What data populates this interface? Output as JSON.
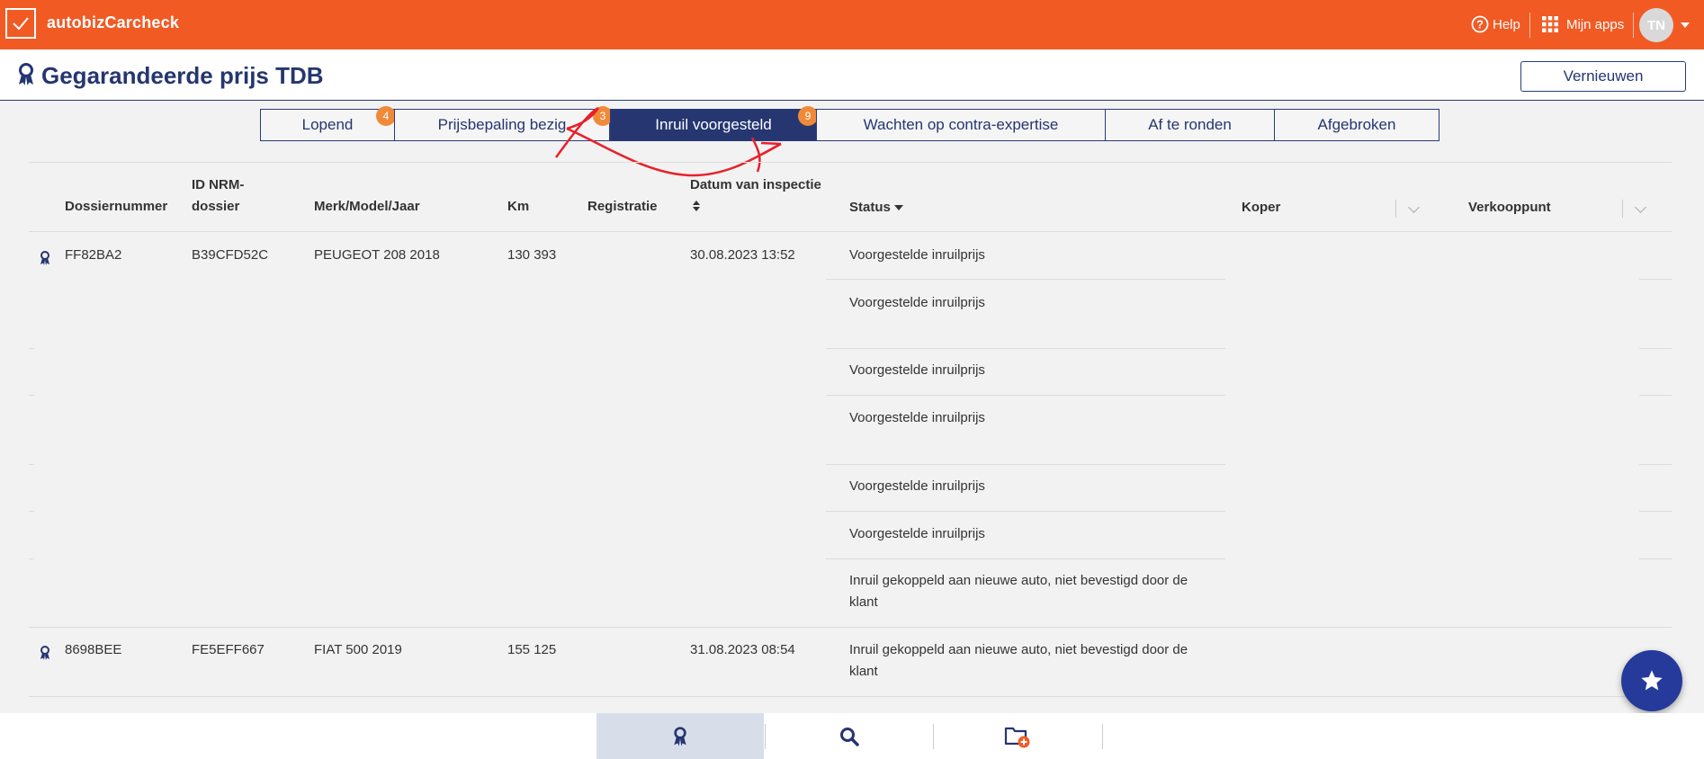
{
  "app": {
    "title": "autobizCarcheck",
    "help_label": "Help",
    "apps_label": "Mijn apps",
    "user_initials": "TN",
    "brand_color": "#f25a24",
    "primary_color": "#253670"
  },
  "header": {
    "title": "Gegarandeerde prijs TDB",
    "refresh_label": "Vernieuwen"
  },
  "tabs": [
    {
      "label": "Lopend",
      "badge": "4",
      "active": false
    },
    {
      "label": "Prijsbepaling bezig",
      "badge": "3",
      "active": false
    },
    {
      "label": "Inruil voorgesteld",
      "badge": "9",
      "active": true
    },
    {
      "label": "Wachten op contra-expertise",
      "badge": "",
      "active": false
    },
    {
      "label": "Af te ronden",
      "badge": "",
      "active": false
    },
    {
      "label": "Afgebroken",
      "badge": "",
      "active": false
    }
  ],
  "table": {
    "headers": {
      "dossier": "Dossiernummer",
      "nrm_line1": "ID NRM-",
      "nrm_line2": "dossier",
      "model": "Merk/Model/Jaar",
      "km": "Km",
      "reg": "Registratie",
      "date": "Datum van inspectie",
      "status": "Status",
      "buyer": "Koper",
      "point": "Verkooppunt"
    },
    "rows": [
      {
        "dossier": "FF82BA2",
        "nrm": "B39CFD52C",
        "model": "PEUGEOT 208 2018",
        "km": "130 393",
        "reg": "",
        "date": "30.08.2023 13:52",
        "statuses": [
          "Voorgestelde inruilprijs",
          "Voorgestelde inruilprijs",
          "Voorgestelde inruilprijs",
          "Voorgestelde inruilprijs",
          "Voorgestelde inruilprijs",
          "Voorgestelde inruilprijs",
          "Inruil gekoppeld aan nieuwe auto, niet bevestigd door de klant"
        ]
      },
      {
        "dossier": "8698BEE",
        "nrm": "FE5EFF667",
        "model": "FIAT 500 2019",
        "km": "155 125",
        "reg": "",
        "date": "31.08.2023 08:54",
        "statuses": [
          "Inruil gekoppeld aan nieuwe auto, niet bevestigd door de klant"
        ]
      }
    ]
  }
}
